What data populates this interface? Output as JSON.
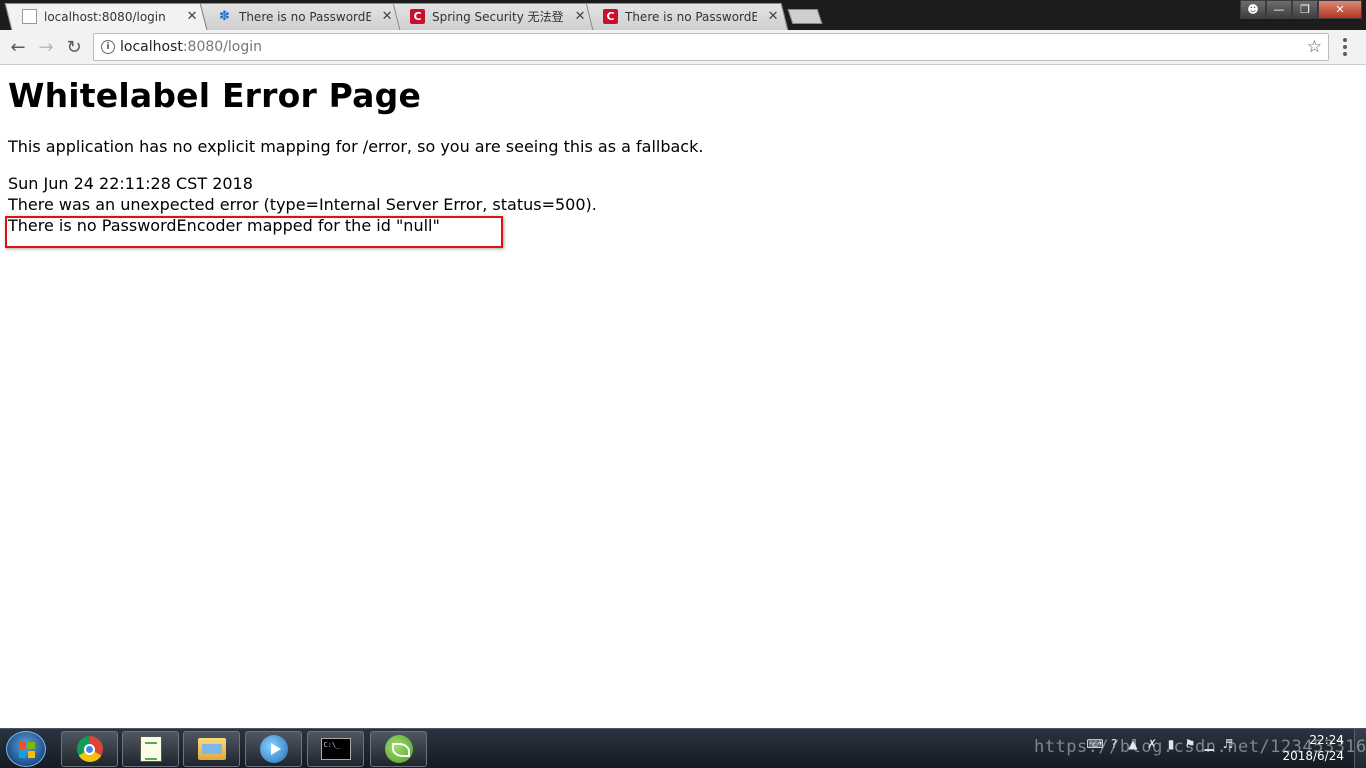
{
  "browser": {
    "tabs": [
      {
        "title": "localhost:8080/login",
        "favicon": "page-icon",
        "active": true
      },
      {
        "title": "There is no PasswordEn",
        "favicon": "baidu-paw-icon",
        "active": false
      },
      {
        "title": "Spring Security 无法登陆",
        "favicon": "csdn-icon",
        "active": false
      },
      {
        "title": "There is no PasswordEn",
        "favicon": "csdn-icon",
        "active": false
      }
    ],
    "close_glyph": "✕",
    "address": {
      "host": "localhost",
      "path": ":8080/login"
    }
  },
  "page": {
    "heading": "Whitelabel Error Page",
    "description": "This application has no explicit mapping for /error, so you are seeing this as a fallback.",
    "timestamp": "Sun Jun 24 22:11:28 CST 2018",
    "error_summary": "There was an unexpected error (type=Internal Server Error, status=500).",
    "error_message": "There is no PasswordEncoder mapped for the id \"null\"",
    "highlight_color": "#e0101a"
  },
  "taskbar": {
    "apps": [
      "chrome-icon",
      "notepad-icon",
      "explorer-folder-icon",
      "media-player-icon",
      "command-prompt-icon",
      "spring-tool-suite-icon"
    ],
    "cmd_label": "C:\\_",
    "watermark": "https://blog.csdn.net/123453316",
    "clock": {
      "time": "22:24",
      "date": "2018/6/24"
    }
  }
}
